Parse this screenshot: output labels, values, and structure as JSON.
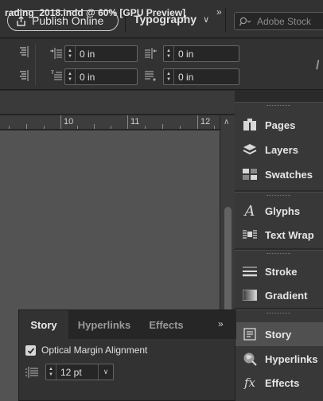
{
  "topbar": {
    "publish_label": "Publish Online",
    "workspace_label": "Typography",
    "search_placeholder": "Adobe Stock"
  },
  "control_panel": {
    "fields": [
      {
        "value": "0 in"
      },
      {
        "value": "0 in"
      },
      {
        "value": "0 in"
      },
      {
        "value": "0 in"
      }
    ]
  },
  "document": {
    "tab_title": "rading_2018.indd @ 60% [GPU Preview]",
    "close_glyph": "×",
    "more_glyph": "»",
    "ruler_numbers": [
      "10",
      "11",
      "12"
    ]
  },
  "dock": {
    "items": [
      {
        "label": "Pages",
        "icon": "pages-icon"
      },
      {
        "label": "Layers",
        "icon": "layers-icon"
      },
      {
        "label": "Swatches",
        "icon": "swatches-icon"
      },
      {
        "label": "Glyphs",
        "icon": "glyphs-icon"
      },
      {
        "label": "Text Wrap",
        "icon": "text-wrap-icon"
      },
      {
        "label": "Stroke",
        "icon": "stroke-icon"
      },
      {
        "label": "Gradient",
        "icon": "gradient-icon"
      },
      {
        "label": "Story",
        "icon": "story-icon"
      },
      {
        "label": "Hyperlinks",
        "icon": "hyperlinks-icon"
      },
      {
        "label": "Effects",
        "icon": "effects-icon"
      }
    ]
  },
  "story_panel": {
    "tabs": [
      {
        "label": "Story"
      },
      {
        "label": "Hyperlinks"
      },
      {
        "label": "Effects"
      }
    ],
    "more_glyph": "»",
    "optical_margin_label": "Optical Margin Alignment",
    "optical_margin_checked": true,
    "size_value": "12 pt"
  },
  "colors": {
    "panel_bg": "#323232",
    "canvas_bg": "#535353",
    "active_item": "#505050"
  }
}
